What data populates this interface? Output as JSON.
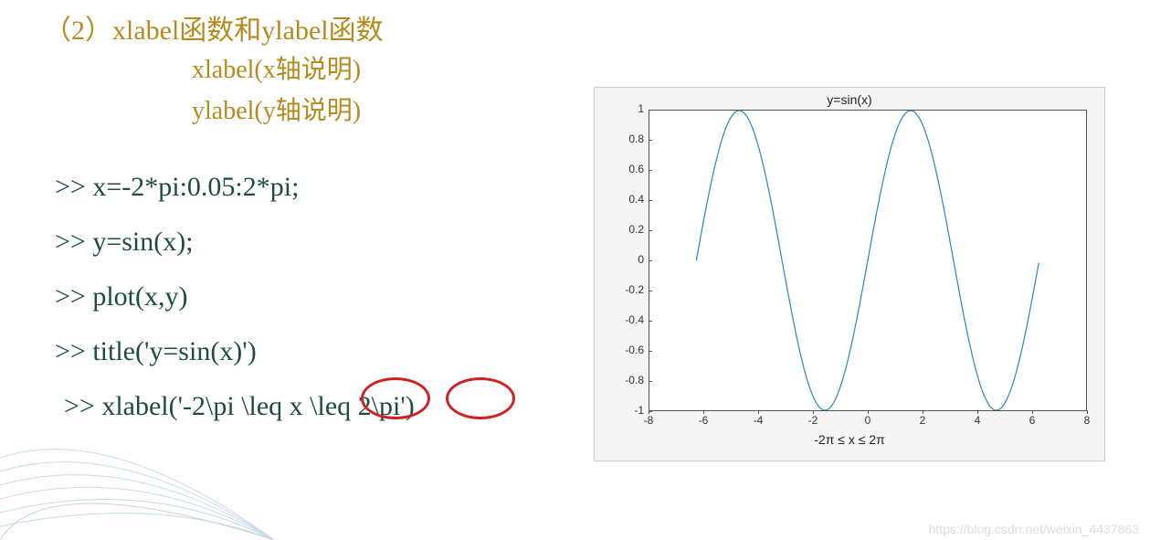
{
  "heading": "（2）xlabel函数和ylabel函数",
  "syntax": {
    "line1": "xlabel(x轴说明)",
    "line2": "ylabel(y轴说明)"
  },
  "code": {
    "l1": ">> x=-2*pi:0.05:2*pi;",
    "l2": ">> y=sin(x);",
    "l3": ">> plot(x,y)",
    "l4": ">> title('y=sin(x)')",
    "l5": ">>  xlabel('-2\\pi \\leq x \\leq 2\\pi')"
  },
  "chart_data": {
    "type": "line",
    "title": "y=sin(x)",
    "xlabel": "-2π ≤ x ≤ 2π",
    "ylabel": "",
    "xlim": [
      -8,
      8
    ],
    "ylim": [
      -1,
      1
    ],
    "xticks": [
      -8,
      -6,
      -4,
      -2,
      0,
      2,
      4,
      6,
      8
    ],
    "yticks": [
      -1,
      -0.8,
      -0.6,
      -0.4,
      -0.2,
      0,
      0.2,
      0.4,
      0.6,
      0.8,
      1
    ],
    "series": [
      {
        "name": "sin(x)",
        "function": "sin",
        "domain": [
          -6.2832,
          6.2832
        ],
        "step": 0.05,
        "color": "#2a87c0"
      }
    ]
  },
  "watermark": "https://blog.csdn.net/weixin_4437863"
}
